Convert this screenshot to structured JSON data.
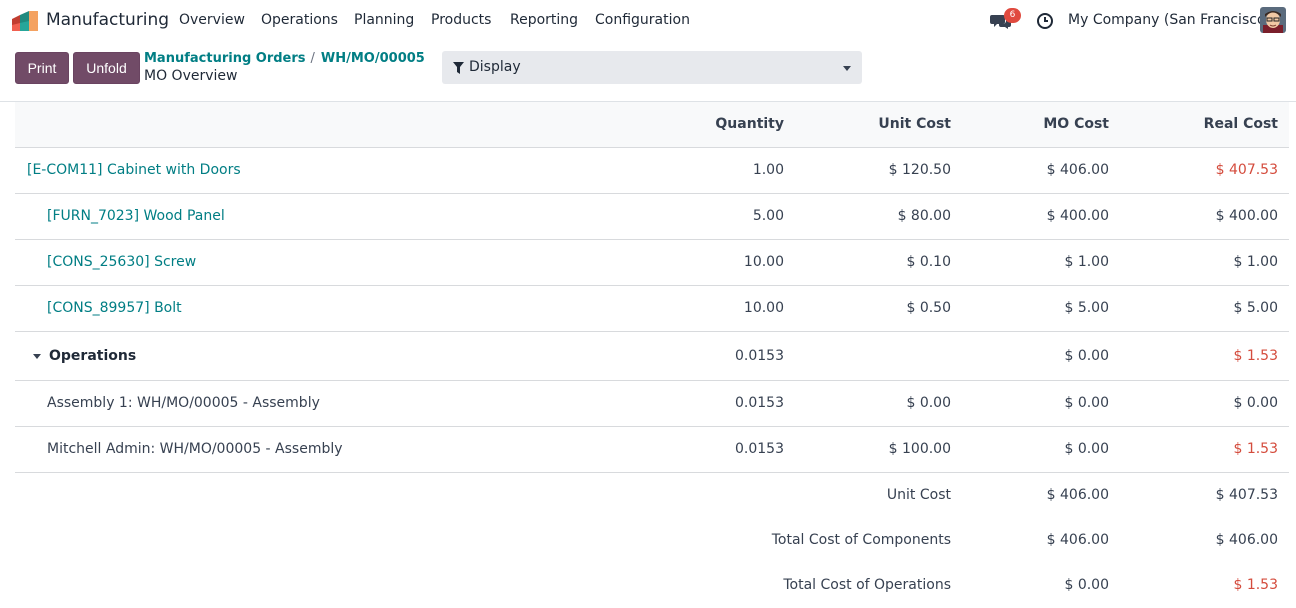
{
  "navbar": {
    "app_name": "Manufacturing",
    "menu": [
      "Overview",
      "Operations",
      "Planning",
      "Products",
      "Reporting",
      "Configuration"
    ],
    "chat_count": "6",
    "company": "My Company (San Francisco)",
    "icons": [
      "manufacturing-app-icon",
      "chat-icon",
      "clock-icon",
      "user-avatar"
    ]
  },
  "control_panel": {
    "print_label": "Print",
    "unfold_label": "Unfold",
    "breadcrumb": [
      "Manufacturing Orders",
      "WH/MO/00005"
    ],
    "breadcrumb_separator": "/",
    "page_title": "MO Overview",
    "display_label": "Display"
  },
  "table": {
    "headers": {
      "quantity": "Quantity",
      "unit_cost": "Unit Cost",
      "mo_cost": "MO Cost",
      "real_cost": "Real Cost"
    },
    "product": {
      "name": "[E-COM11] Cabinet with Doors",
      "quantity": "1.00",
      "unit_cost": "$ 120.50",
      "mo_cost": "$ 406.00",
      "real_cost": "$ 407.53"
    },
    "components": [
      {
        "name": "[FURN_7023] Wood Panel",
        "quantity": "5.00",
        "unit_cost": "$ 80.00",
        "mo_cost": "$ 400.00",
        "real_cost": "$ 400.00"
      },
      {
        "name": "[CONS_25630] Screw",
        "quantity": "10.00",
        "unit_cost": "$ 0.10",
        "mo_cost": "$ 1.00",
        "real_cost": "$ 1.00"
      },
      {
        "name": "[CONS_89957] Bolt",
        "quantity": "10.00",
        "unit_cost": "$ 0.50",
        "mo_cost": "$ 5.00",
        "real_cost": "$ 5.00"
      }
    ],
    "operations_group": {
      "label": "Operations",
      "quantity": "0.0153",
      "mo_cost": "$ 0.00",
      "real_cost": "$ 1.53"
    },
    "operations": [
      {
        "name": "Assembly 1: WH/MO/00005 - Assembly",
        "quantity": "0.0153",
        "unit_cost": "$ 0.00",
        "mo_cost": "$ 0.00",
        "real_cost": "$ 0.00"
      },
      {
        "name": "Mitchell Admin: WH/MO/00005 - Assembly",
        "quantity": "0.0153",
        "unit_cost": "$ 100.00",
        "mo_cost": "$ 0.00",
        "real_cost": "$ 1.53"
      }
    ],
    "totals": [
      {
        "label": "Unit Cost",
        "mo_cost": "$ 406.00",
        "real_cost": "$ 407.53"
      },
      {
        "label": "Total Cost of Components",
        "mo_cost": "$ 406.00",
        "real_cost": "$ 406.00"
      },
      {
        "label": "Total Cost of Operations",
        "mo_cost": "$ 0.00",
        "real_cost": "$ 1.53"
      }
    ]
  },
  "colors": {
    "brand": "#714b67",
    "link": "#017e84",
    "overspent": "#d44c3d"
  }
}
